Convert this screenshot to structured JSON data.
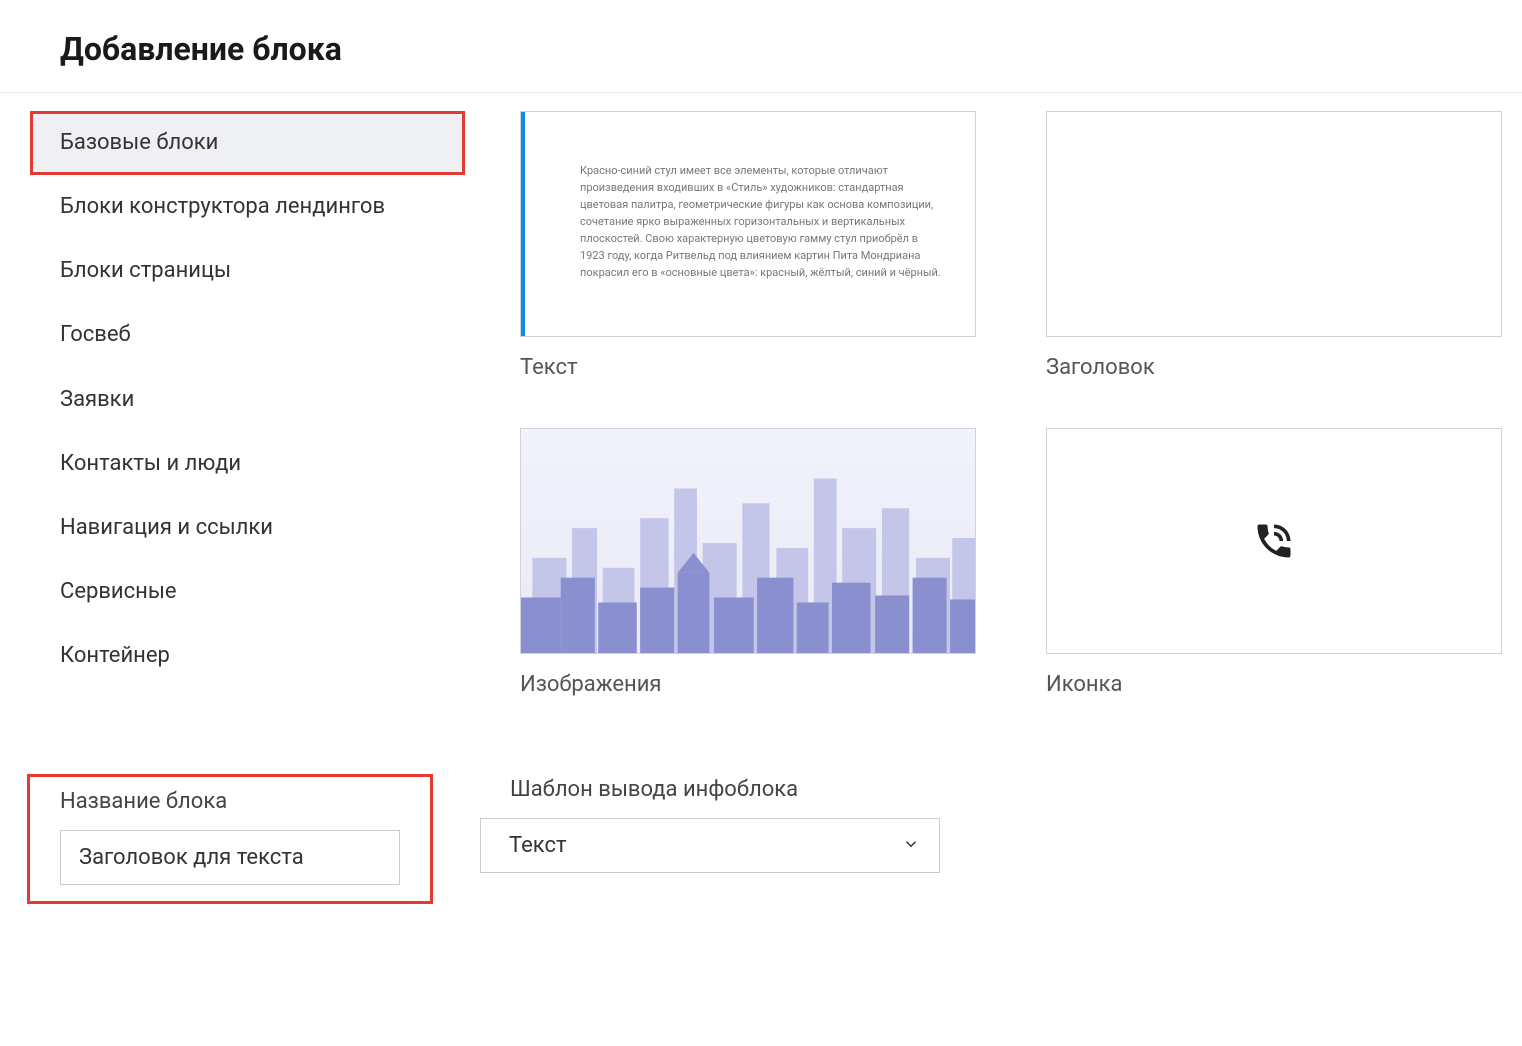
{
  "page_title": "Добавление блока",
  "sidebar": {
    "items": [
      {
        "label": "Базовые блоки",
        "active": true,
        "highlighted": true
      },
      {
        "label": "Блоки конструктора лендингов",
        "active": false,
        "highlighted": false
      },
      {
        "label": "Блоки страницы",
        "active": false,
        "highlighted": false
      },
      {
        "label": "Госвеб",
        "active": false,
        "highlighted": false
      },
      {
        "label": "Заявки",
        "active": false,
        "highlighted": false
      },
      {
        "label": "Контакты и люди",
        "active": false,
        "highlighted": false
      },
      {
        "label": "Навигация и ссылки",
        "active": false,
        "highlighted": false
      },
      {
        "label": "Сервисные",
        "active": false,
        "highlighted": false
      },
      {
        "label": "Контейнер",
        "active": false,
        "highlighted": false
      }
    ]
  },
  "grid": {
    "text_label": "Текст",
    "text_sample": "Красно-синий стул имеет все элементы, которые отличают произведения входивших в «Стиль» художников: стандартная цветовая палитра, геометрические фигуры как основа композиции, сочетание ярко выраженных горизонтальных и вертикальных плоскостей. Свою характерную цветовую гамму стул приобрёл в 1923 году, когда Ритвельд под влиянием картин Пита Мондриана покрасил его в «основные цвета»: красный, жёлтый, синий и чёрный.",
    "heading_label": "Заголовок",
    "image_label": "Изображения",
    "icon_label": "Иконка"
  },
  "form": {
    "name_label": "Название блока",
    "name_value": "Заголовок для текста",
    "template_label": "Шаблон вывода инфоблока",
    "template_value": "Текст"
  }
}
